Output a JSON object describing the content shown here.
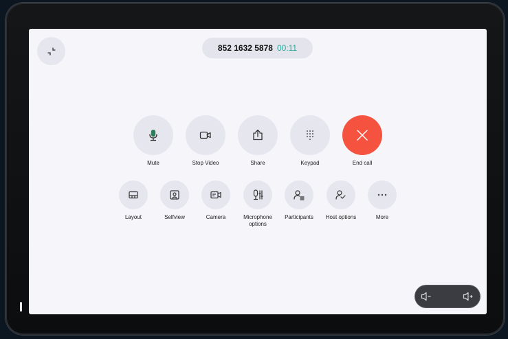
{
  "call": {
    "number": "852 1632 5878",
    "timer": "00:11"
  },
  "primary_controls": [
    {
      "label": "Mute",
      "icon": "microphone-icon"
    },
    {
      "label": "Stop Video",
      "icon": "video-camera-icon"
    },
    {
      "label": "Share",
      "icon": "share-icon"
    },
    {
      "label": "Keypad",
      "icon": "keypad-icon"
    },
    {
      "label": "End call",
      "icon": "close-icon"
    }
  ],
  "secondary_controls": [
    {
      "label": "Layout",
      "icon": "layout-icon"
    },
    {
      "label": "Selfview",
      "icon": "selfview-icon"
    },
    {
      "label": "Camera",
      "icon": "camera-icon"
    },
    {
      "label": "Microphone options",
      "icon": "microphone-options-icon"
    },
    {
      "label": "Participants",
      "icon": "participants-icon"
    },
    {
      "label": "Host options",
      "icon": "host-options-icon"
    },
    {
      "label": "More",
      "icon": "more-icon"
    }
  ],
  "volume": {
    "down_icon": "volume-down-icon",
    "up_icon": "volume-up-icon"
  },
  "colors": {
    "end_call": "#f5533f",
    "timer": "#2aa69a",
    "button_bg": "#e6e6ef",
    "screen_bg": "#f5f5fa"
  }
}
